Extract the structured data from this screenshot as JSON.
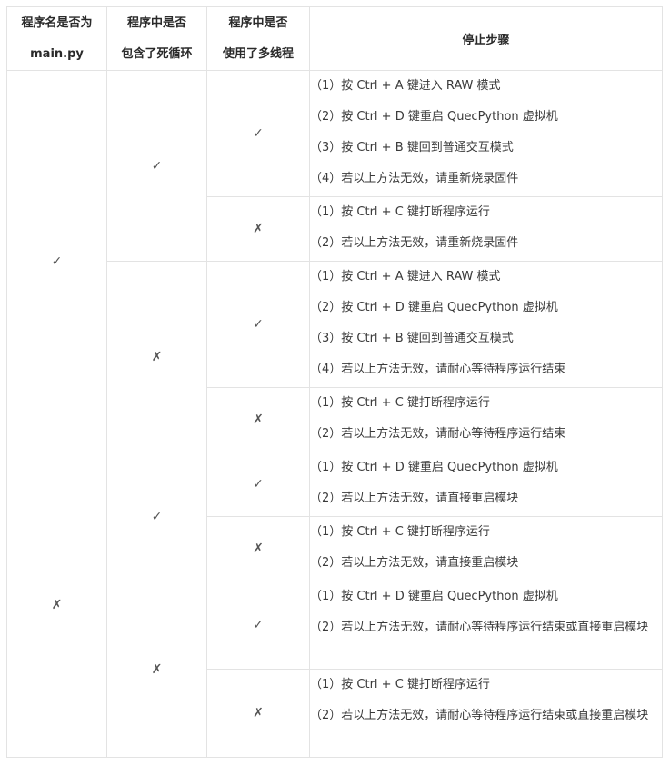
{
  "headers": {
    "col1": [
      "程序名是否为",
      "main.py"
    ],
    "col2": [
      "程序中是否",
      "包含了死循环"
    ],
    "col3": [
      "程序中是否",
      "使用了多线程"
    ],
    "col4": "停止步骤"
  },
  "marks": {
    "yes": "✓",
    "no": "✗"
  },
  "rows": [
    {
      "main": "✓",
      "loop": "✓",
      "thread": "✓",
      "steps": [
        "（1）按 Ctrl + A 键进入 RAW 模式",
        "（2）按 Ctrl + D 键重启 QuecPython 虚拟机",
        "（3）按 Ctrl + B 键回到普通交互模式",
        "（4）若以上方法无效，请重新烧录固件"
      ]
    },
    {
      "thread": "✗",
      "steps": [
        "（1）按 Ctrl + C 键打断程序运行",
        "（2）若以上方法无效，请重新烧录固件"
      ]
    },
    {
      "loop": "✗",
      "thread": "✓",
      "steps": [
        "（1）按 Ctrl + A 键进入 RAW 模式",
        "（2）按 Ctrl + D 键重启 QuecPython 虚拟机",
        "（3）按 Ctrl + B 键回到普通交互模式",
        "（4）若以上方法无效，请耐心等待程序运行结束"
      ]
    },
    {
      "thread": "✗",
      "steps": [
        "（1）按 Ctrl + C 键打断程序运行",
        "（2）若以上方法无效，请耐心等待程序运行结束"
      ]
    },
    {
      "main": "✗",
      "loop": "✓",
      "thread": "✓",
      "steps": [
        "（1）按 Ctrl + D 键重启 QuecPython 虚拟机",
        "（2）若以上方法无效，请直接重启模块"
      ]
    },
    {
      "thread": "✗",
      "steps": [
        "（1）按 Ctrl + C 键打断程序运行",
        "（2）若以上方法无效，请直接重启模块"
      ]
    },
    {
      "loop": "✗",
      "thread": "✓",
      "steps": [
        "（1）按 Ctrl + D 键重启 QuecPython 虚拟机",
        "（2）若以上方法无效，请耐心等待程序运行结束或直接重启模块"
      ]
    },
    {
      "thread": "✗",
      "steps": [
        "（1）按 Ctrl + C 键打断程序运行",
        "（2）若以上方法无效，请耐心等待程序运行结束或直接重启模块"
      ]
    }
  ]
}
